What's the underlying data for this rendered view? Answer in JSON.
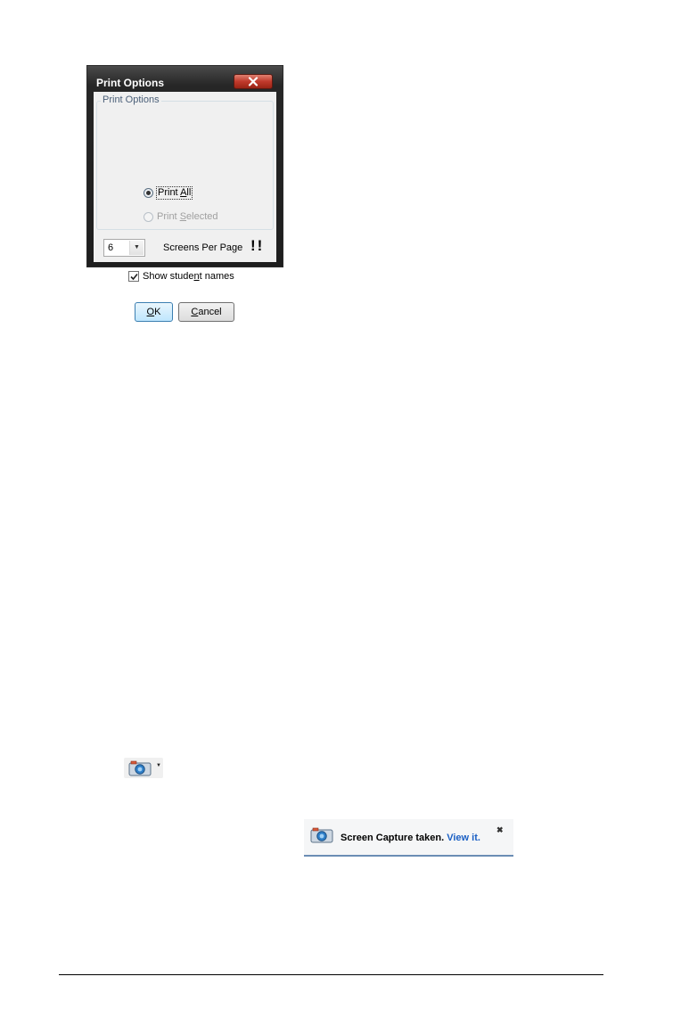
{
  "dialog": {
    "title": "Print Options",
    "group_label": "Print Options",
    "print_all": {
      "label_pre": "Print ",
      "mnemonic": "A",
      "label_post": "ll",
      "selected": true
    },
    "print_selected": {
      "label_pre": "Print ",
      "mnemonic": "S",
      "label_post": "elected",
      "enabled": false
    },
    "screens_per_page": {
      "value": "6",
      "label": "Screens Per Page",
      "alert_text": "!!"
    },
    "show_student_names": {
      "label_pre": "Show stude",
      "mnemonic": "n",
      "label_post": "t names",
      "checked": true
    },
    "ok_button": {
      "mnemonic": "O",
      "label_post": "K"
    },
    "cancel_button": {
      "mnemonic": "C",
      "label_post": "ancel"
    }
  },
  "toolbar": {
    "camera_icon": "camera-icon",
    "dropdown_icon": "dropdown-arrow-icon"
  },
  "notification": {
    "message": "Screen Capture taken.",
    "link": "View it.",
    "close_icon": "close-icon"
  }
}
